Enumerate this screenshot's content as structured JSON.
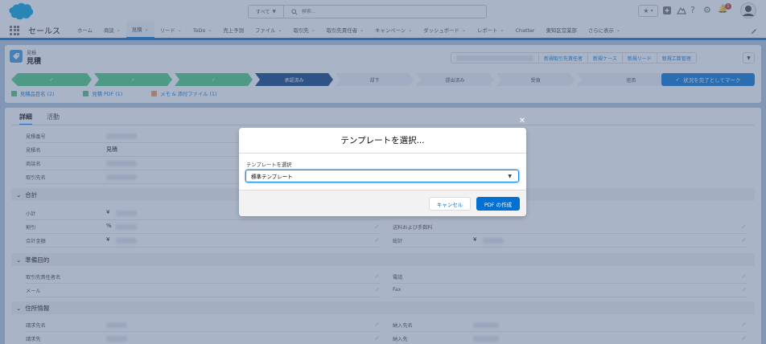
{
  "header": {
    "search_scope": "すべて",
    "search_placeholder": "検索...",
    "app_name": "セールス",
    "nav": [
      {
        "label": "ホーム",
        "chevron": false
      },
      {
        "label": "商談",
        "chevron": true
      },
      {
        "label": "見積",
        "chevron": true
      },
      {
        "label": "リード",
        "chevron": true
      },
      {
        "label": "ToDo",
        "chevron": true
      },
      {
        "label": "売上予測",
        "chevron": false
      },
      {
        "label": "ファイル",
        "chevron": true
      },
      {
        "label": "取引先",
        "chevron": true
      },
      {
        "label": "取引先責任者",
        "chevron": true
      },
      {
        "label": "キャンペーン",
        "chevron": true
      },
      {
        "label": "ダッシュボード",
        "chevron": true
      },
      {
        "label": "レポート",
        "chevron": true
      },
      {
        "label": "Chatter",
        "chevron": false
      },
      {
        "label": "東知区営業部",
        "chevron": false
      },
      {
        "label": "さらに表示",
        "chevron": true
      }
    ],
    "active_nav": "見積",
    "notification_count": "1"
  },
  "record": {
    "object_label": "見積",
    "title": "見積",
    "actions": [
      "新規取引先責任者",
      "新規ケース",
      "新規リード",
      "新規工数管理"
    ],
    "path_steps": [
      {
        "label": "",
        "state": "done"
      },
      {
        "label": "",
        "state": "done"
      },
      {
        "label": "",
        "state": "done"
      },
      {
        "label": "承認済み",
        "state": "current"
      },
      {
        "label": "却下",
        "state": "todo"
      },
      {
        "label": "提出済み",
        "state": "todo"
      },
      {
        "label": "受領",
        "state": "todo"
      },
      {
        "label": "拒否",
        "state": "todo"
      }
    ],
    "complete_button": "状況を完了としてマーク",
    "related": [
      {
        "label": "見積品目名 (2)",
        "color": "#4bc076"
      },
      {
        "label": "見積 PDF (1)",
        "color": "#4bc076"
      },
      {
        "label": "メモ & 添付ファイル (1)",
        "color": "#f49756"
      }
    ]
  },
  "detail": {
    "tabs": [
      "詳細",
      "活動"
    ],
    "fields_left": [
      {
        "label": "見積番号",
        "value": ""
      },
      {
        "label": "見積名",
        "value": "見積"
      },
      {
        "label": "商談名",
        "value": ""
      },
      {
        "label": "取引先名",
        "value": ""
      }
    ],
    "section_total": "合計",
    "total_fields": [
      {
        "label": "小計",
        "value": "¥"
      },
      {
        "label": "割引",
        "value": "%"
      },
      {
        "label": "合計金額",
        "value": "¥"
      }
    ],
    "total_right": [
      {
        "label": "送料および手数料",
        "value": ""
      },
      {
        "label": "総計",
        "value": "¥"
      }
    ],
    "section_prep": "準備目的",
    "prep_left": [
      {
        "label": "取引先責任者名",
        "value": ""
      },
      {
        "label": "メール",
        "value": ""
      }
    ],
    "prep_right": [
      {
        "label": "電話",
        "value": ""
      },
      {
        "label": "Fax",
        "value": ""
      }
    ],
    "section_address": "住所情報",
    "address_left": [
      {
        "label": "請求先名",
        "value": ""
      },
      {
        "label": "請求先",
        "value": ""
      }
    ],
    "address_right": [
      {
        "label": "納入先名",
        "value": ""
      },
      {
        "label": "納入先",
        "value": ""
      }
    ]
  },
  "modal": {
    "title": "テンプレートを選択...",
    "select_label": "テンプレートを選択",
    "select_value": "標準テンプレート",
    "cancel": "キャンセル",
    "create": "PDF の作成"
  },
  "colors": {
    "brand": "#0070d2",
    "path_done": "#4bca81",
    "path_current": "#0b3d7a",
    "overlay": "#54698d"
  }
}
